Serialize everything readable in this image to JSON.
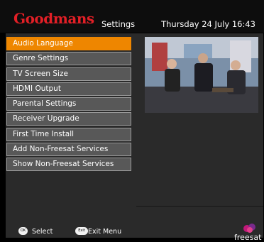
{
  "header": {
    "brand": "Goodmans",
    "title": "Settings",
    "datetime": "Thursday 24 July  16:43"
  },
  "menu": {
    "items": [
      {
        "label": "Audio Language",
        "selected": true
      },
      {
        "label": "Genre Settings",
        "selected": false
      },
      {
        "label": "TV Screen Size",
        "selected": false
      },
      {
        "label": "HDMI Output",
        "selected": false
      },
      {
        "label": "Parental Settings",
        "selected": false
      },
      {
        "label": "Receiver Upgrade",
        "selected": false
      },
      {
        "label": "First Time Install",
        "selected": false
      },
      {
        "label": "Add Non-Freesat Services",
        "selected": false
      },
      {
        "label": "Show Non-Freesat Services",
        "selected": false
      }
    ]
  },
  "footer": {
    "ok_icon_text": "OK",
    "ok_label": "Select",
    "exit_icon_text": "Exit",
    "exit_label": "Exit Menu",
    "logo_text": "freesat"
  },
  "colors": {
    "brand": "#e21f26",
    "selected": "#ee8600",
    "item": "#585858",
    "panel": "#2a2a2a"
  }
}
